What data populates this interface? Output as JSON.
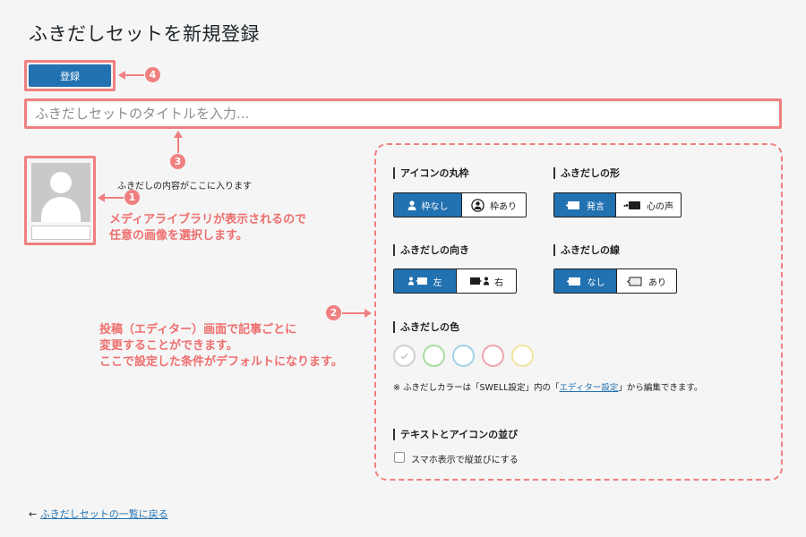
{
  "page": {
    "title": "ふきだしセットを新規登録"
  },
  "toolbar": {
    "submit_label": "登録"
  },
  "title_field": {
    "placeholder": "ふきだしセットのタイトルを入力..."
  },
  "preview": {
    "text": "ふきだしの内容がここに入ります"
  },
  "annotations": {
    "num1": "1",
    "num2": "2",
    "num3": "3",
    "num4": "4",
    "note1": [
      "メディアライブラリが表示されるので",
      "任意の画像を選択します。"
    ],
    "note2": [
      "投稿（エディター）画面で記事ごとに",
      "変更することができます。",
      "ここで設定した条件がデフォルトになります。"
    ]
  },
  "settings": {
    "icon_frame": {
      "label": "アイコンの丸枠",
      "options": [
        "枠なし",
        "枠あり"
      ],
      "selected": 0
    },
    "balloon_shape": {
      "label": "ふきだしの形",
      "options": [
        "発言",
        "心の声"
      ],
      "selected": 0
    },
    "balloon_direction": {
      "label": "ふきだしの向き",
      "options": [
        "左",
        "右"
      ],
      "selected": 0
    },
    "balloon_border": {
      "label": "ふきだしの線",
      "options": [
        "なし",
        "あり"
      ],
      "selected": 0
    },
    "balloon_color": {
      "label": "ふきだしの色",
      "swatches": [
        {
          "name": "gray",
          "color": "#d0d0d0"
        },
        {
          "name": "green",
          "color": "#a8dca0"
        },
        {
          "name": "blue",
          "color": "#a4d2e8"
        },
        {
          "name": "red",
          "color": "#f0a5b0"
        },
        {
          "name": "yellow",
          "color": "#f2e3a0"
        }
      ],
      "note_prefix": "※ ふきだしカラーは「SWELL設定」内の「",
      "note_link": "エディター設定",
      "note_suffix": "」から編集できます。"
    },
    "layout": {
      "label": "テキストとアイコンの並び",
      "checkbox_label": "スマホ表示で縦並びにする",
      "checked": false
    }
  },
  "footer": {
    "back_arrow": "←",
    "back_link": "ふきだしセットの一覧に戻る"
  },
  "colors": {
    "accent": "#2271b1",
    "annotation": "#f08080"
  }
}
